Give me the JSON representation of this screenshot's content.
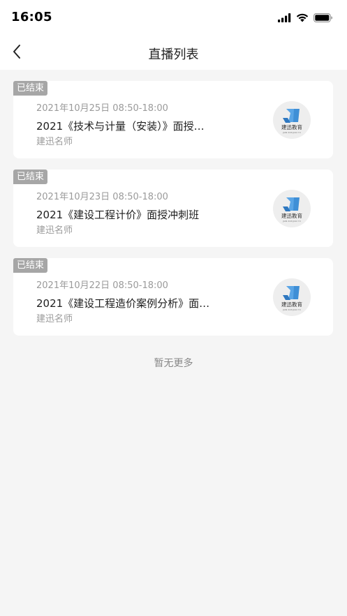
{
  "status_bar": {
    "time": "16:05",
    "icons": [
      "signal-icon",
      "wifi-icon",
      "battery-icon"
    ]
  },
  "nav": {
    "back_icon": "chevron-left-icon",
    "title": "直播列表"
  },
  "live_list": [
    {
      "status": "已结束",
      "time": "2021年10月25日 08:50-18:00",
      "title": "2021《技术与计量（安装）》面授…",
      "teacher": "建迅名师",
      "logo_text": "建迅教育",
      "logo_subtext": "JIAN XUN JIAO YU"
    },
    {
      "status": "已结束",
      "time": "2021年10月23日 08:50-18:00",
      "title": "2021《建设工程计价》面授冲刺班",
      "teacher": "建迅名师",
      "logo_text": "建迅教育",
      "logo_subtext": "JIAN XUN JIAO YU"
    },
    {
      "status": "已结束",
      "time": "2021年10月22日 08:50-18:00",
      "title": "2021《建设工程造价案例分析》面…",
      "teacher": "建迅名师",
      "logo_text": "建迅教育",
      "logo_subtext": "JIAN XUN JIAO YU"
    }
  ],
  "footer": {
    "no_more": "暂无更多"
  },
  "colors": {
    "badge": "#a6a6a6",
    "background": "#f5f5f5",
    "card": "#ffffff",
    "logo_blue": "#3f8fd6"
  }
}
